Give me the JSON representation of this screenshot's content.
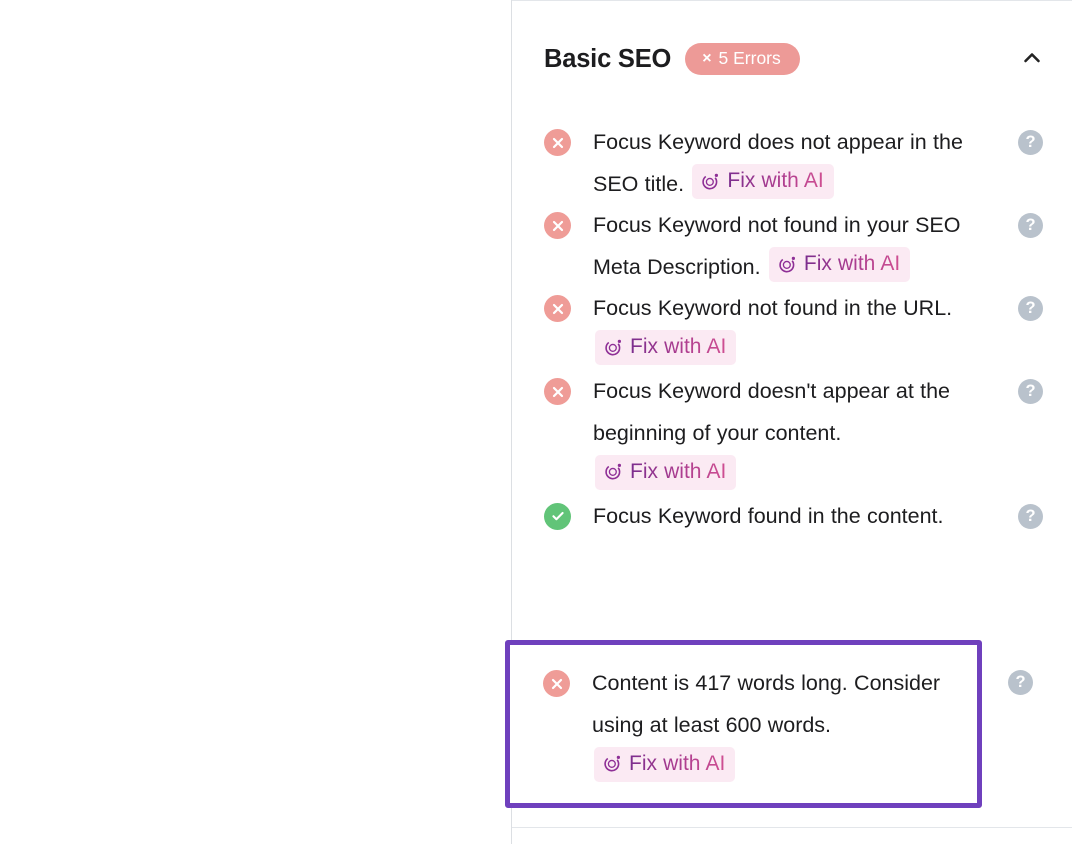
{
  "header": {
    "title": "Basic SEO",
    "badge": {
      "x_glyph": "×",
      "label": "5 Errors",
      "color": "#ed9a97"
    },
    "collapse_icon": "chevron-up-icon"
  },
  "colors": {
    "error": "#ef9c97",
    "success": "#61c478",
    "highlight": "#6f40bd",
    "fix_ai_bg": "#fbeaf3",
    "help_icon": "#b9c2cc"
  },
  "fix_ai": {
    "label": "Fix with AI",
    "icon": "ai-circle-icon"
  },
  "help": {
    "glyph": "?"
  },
  "items": [
    {
      "status": "error",
      "text_before": "Focus Keyword does not appear in the SEO title.",
      "has_fix_ai": true
    },
    {
      "status": "error",
      "text_before": "Focus Keyword not found in your SEO Meta Description.",
      "has_fix_ai": true
    },
    {
      "status": "error",
      "text_before": "Focus Keyword not found in the URL.",
      "has_fix_ai": true
    },
    {
      "status": "error",
      "text_before": "Focus Keyword doesn't appear at the beginning of your content.",
      "has_fix_ai": true
    },
    {
      "status": "ok",
      "text_before": "Focus Keyword found in the content.",
      "has_fix_ai": false
    }
  ],
  "highlighted_item": {
    "status": "error",
    "text_before": "Content is 417 words long. Consider using at least 600 words.",
    "has_fix_ai": true
  }
}
